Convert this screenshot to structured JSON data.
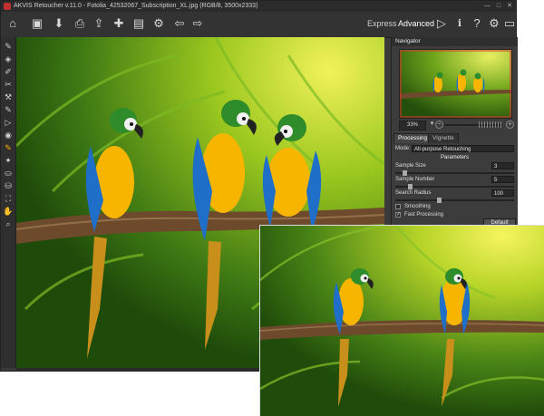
{
  "titlebar": {
    "title": "AKVIS Retoucher v.11.0 - Fotolia_42532067_Subscription_XL.jpg (RGB/8, 3500x2333)",
    "minimize_glyph": "—",
    "maximize_glyph": "□",
    "close_glyph": "✕"
  },
  "toolbar": {
    "icons": [
      "home-icon",
      "open-icon",
      "save-icon",
      "print-icon",
      "share-icon",
      "plugin-icon",
      "batch-icon",
      "settings-icon",
      "undo-icon",
      "redo-icon"
    ],
    "glyphs": [
      "⌂",
      "▣",
      "⬇",
      "⎙",
      "⇪",
      "✚",
      "▤",
      "⚙",
      "⇦",
      "⇨"
    ],
    "modes": {
      "express": "Express",
      "advanced": "Advanced"
    },
    "run_glyph": "▷",
    "info_glyph": "ℹ",
    "help_glyph": "?",
    "prefs_glyph": "⚙",
    "display_glyph": "▭"
  },
  "lefttools": [
    "✎",
    "◈",
    "✐",
    "✂",
    "⚒",
    "✎",
    "▷",
    "◉",
    "✎",
    "✦",
    "⛀",
    "⛁",
    "⛶",
    "✋",
    "⌕"
  ],
  "navigator": {
    "title": "Navigator",
    "zoom": "33%",
    "zoom_out": "−",
    "zoom_in": "+",
    "zoom_arrow": "▾"
  },
  "tabs": {
    "processing": "Processing",
    "vignette": "Vignette"
  },
  "params": {
    "mode_label": "Mode:",
    "mode_value": "All-purpose Retouching",
    "section": "Parameters",
    "sample_size_label": "Sample Size",
    "sample_size_value": "3",
    "sample_number_label": "Sample Number",
    "sample_number_value": "5",
    "search_radius_label": "Search Radius",
    "search_radius_value": "100",
    "smoothing_label": "Smoothing",
    "fast_label": "Fast Processing",
    "fast_check": "✓",
    "default_button": "Default"
  },
  "colors": {
    "accent": "#3a3a3a",
    "parrot_blue": "#2a7fd0",
    "parrot_yellow": "#f5b800"
  }
}
